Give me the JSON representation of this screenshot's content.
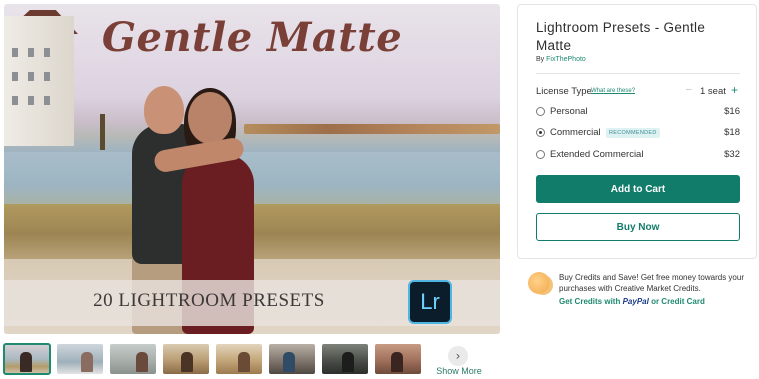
{
  "hero": {
    "title": "Gentle Matte",
    "band_text": "20 LIGHTROOM PRESETS",
    "badge": "Lr"
  },
  "thumbnails": {
    "count": 8,
    "next_icon": "chevron-right-icon",
    "show_more": "Show More"
  },
  "product": {
    "title": "Lightroom Presets - Gentle Matte",
    "by_prefix": "By",
    "author": "FixThePhoto",
    "license_label": "License Type",
    "what_link": "What are these?",
    "seat_minus": "–",
    "seat_label": "1 seat",
    "seat_plus": "+",
    "options": [
      {
        "label": "Personal",
        "price": "$16",
        "selected": false
      },
      {
        "label": "Commercial",
        "price": "$18",
        "selected": true,
        "badge": "RECOMMENDED"
      },
      {
        "label": "Extended Commercial",
        "price": "$32",
        "selected": false
      }
    ],
    "add_to_cart": "Add to Cart",
    "buy_now": "Buy Now"
  },
  "credits": {
    "text": "Buy Credits and Save! Get free money towards your purchases with Creative Market Credits.",
    "link_prefix": "Get Credits with",
    "paypal": "PayPal",
    "link_suffix": "or Credit Card"
  },
  "colors": {
    "accent": "#127c6b",
    "title_script": "#7a4038",
    "badge_bg": "#dff2f3"
  }
}
